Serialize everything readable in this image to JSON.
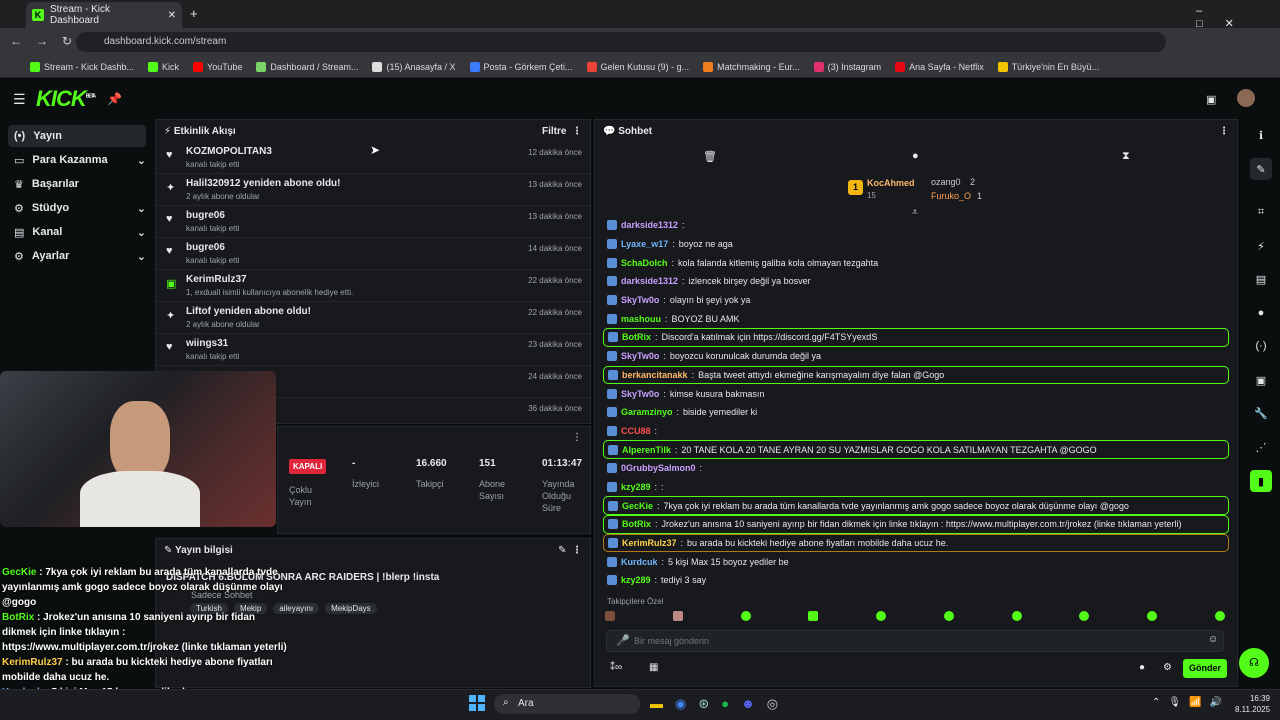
{
  "browser": {
    "tab_title": "Stream - Kick Dashboard",
    "url": "dashboard.kick.com/stream",
    "bookmarks": [
      "Stream - Kick Dashb...",
      "Kick",
      "YouTube",
      "Dashboard / Stream...",
      "(15) Anasayfa / X",
      "Posta - Görkem Çeti...",
      "Gelen Kutusu (9) - g...",
      "Matchmaking - Eur...",
      "(3) Instagram",
      "Ana Sayfa - Netflix",
      "Türkiye'nin En Büyü..."
    ]
  },
  "header": {
    "logo": "KICK",
    "beta": "BETA"
  },
  "nav": [
    {
      "label": "Yayın"
    },
    {
      "label": "Para Kazanma"
    },
    {
      "label": "Başarılar"
    },
    {
      "label": "Stüdyo"
    },
    {
      "label": "Kanal"
    },
    {
      "label": "Ayarlar"
    }
  ],
  "activity": {
    "title": "Etkinlik Akışı",
    "filter": "Filtre",
    "events": [
      {
        "name": "KOZMOPOLITAN3",
        "sub": "kanalı takip etti",
        "time": "12 dakika önce",
        "icon": "heart"
      },
      {
        "name": "Halil320912 yeniden abone oldu!",
        "sub": "2 aylık abone oldular",
        "time": "13 dakika önce",
        "icon": "star"
      },
      {
        "name": "bugre06",
        "sub": "kanalı takip etti",
        "time": "13 dakika önce",
        "icon": "heart"
      },
      {
        "name": "bugre06",
        "sub": "kanalı takip etti",
        "time": "14 dakika önce",
        "icon": "heart"
      },
      {
        "name": "KerimRulz37",
        "sub": "1, exduall isimli kullanıcıya abonelik hediye etti.",
        "time": "22 dakika önce",
        "icon": "gift"
      },
      {
        "name": "Liftof yeniden abone oldu!",
        "sub": "2 aylık abone oldular",
        "time": "22 dakika önce",
        "icon": "star"
      },
      {
        "name": "wiings31",
        "sub": "kanalı takip etti",
        "time": "23 dakika önce",
        "icon": "heart"
      },
      {
        "name": "",
        "sub": "",
        "time": "24 dakika önce",
        "icon": ""
      },
      {
        "name": "",
        "sub": "",
        "time": "36 dakika önce",
        "icon": ""
      }
    ]
  },
  "stats": {
    "status": "KAPALI",
    "items": [
      {
        "value": "-",
        "label": "İzleyici"
      },
      {
        "value": "16.660",
        "label": "Takipçi"
      },
      {
        "value": "151",
        "label": "Abone Sayısı"
      },
      {
        "value": "01:13:47",
        "label": "Yayında Olduğu Süre"
      }
    ],
    "multi": "Çoklu Yayın"
  },
  "streaminfo": {
    "title": "Yayın bilgisi",
    "stream_title": "DISPATCH 6.BÖLÜM SONRA ARC RAIDERS | !blerp !insta",
    "mode": "Sadece Sohbet",
    "tags": [
      "Turkish",
      "Mekip",
      "aileyayını",
      "MekipDays"
    ]
  },
  "chat": {
    "title": "Sohbet",
    "leader_1": "KocAhmed",
    "leader_1_count": "15",
    "leader_2": "ozang0",
    "leader_2_count": "2",
    "leader_3": "Furuko_O",
    "leader_3_count": "1",
    "messages": [
      {
        "user": "darkside1312",
        "text": "",
        "color": "#c9a0ff",
        "hl": ""
      },
      {
        "user": "Lyaxe_w17",
        "text": "boyoz ne aga",
        "color": "#70b7ff",
        "hl": ""
      },
      {
        "user": "SchaDolch",
        "text": "kola falanda kitlemiş galiba kola olmayan tezgahta",
        "color": "#53fc18",
        "hl": ""
      },
      {
        "user": "darkside1312",
        "text": "izlencek birşey değil ya bosver",
        "color": "#c9a0ff",
        "hl": ""
      },
      {
        "user": "SkyTw0o",
        "text": "olayın bi şeyi yok ya",
        "color": "#c9a0ff",
        "hl": ""
      },
      {
        "user": "mashouu",
        "text": "BOYOZ BU AMK",
        "color": "#53fc18",
        "hl": ""
      },
      {
        "user": "BotRix",
        "text": "Discord'a katılmak için https://discord.gg/F4TSYyexdS",
        "color": "#53fc18",
        "hl": "g"
      },
      {
        "user": "SkyTw0o",
        "text": "boyozcu korunulcak durumda değil ya",
        "color": "#c9a0ff",
        "hl": ""
      },
      {
        "user": "berkancitanakk",
        "text": "Başta tweet attıydı ekmeğine karışmayalım diye falan @Gogo",
        "color": "#ffb86b",
        "hl": "g"
      },
      {
        "user": "SkyTw0o",
        "text": "kimse kusura bakmasın",
        "color": "#c9a0ff",
        "hl": ""
      },
      {
        "user": "Garamzinyo",
        "text": "biside yemediler ki",
        "color": "#53fc18",
        "hl": ""
      },
      {
        "user": "CCU88",
        "text": "",
        "color": "#ff4d4d",
        "hl": ""
      },
      {
        "user": "AlperenTilk",
        "text": "20 TANE KOLA 20 TANE AYRAN 20 SU YAZMISLAR GOGO KOLA SATILMAYAN TEZGAHTA @GOGO",
        "color": "#53fc18",
        "hl": "g"
      },
      {
        "user": "0GrubbySalmon0",
        "text": "",
        "color": "#c9a0ff",
        "hl": ""
      },
      {
        "user": "kzy289",
        "text": ":",
        "color": "#53fc18",
        "hl": ""
      },
      {
        "user": "GecKie",
        "text": "7kya çok iyi reklam bu arada tüm kanallarda tvde yayınlanmış amk gogo sadece boyoz olarak düşünme olayı @gogo",
        "color": "#53fc18",
        "hl": "g"
      },
      {
        "user": "BotRix",
        "text": "Jrokez'un anısına 10 saniyeni ayırıp bir fidan dikmek için linke tıklayın : https://www.multiplayer.com.tr/jrokez (linke tıklaman yeterli)",
        "color": "#53fc18",
        "hl": "g"
      },
      {
        "user": "KerimRulz37",
        "text": "bu arada bu kickteki hediye abone fiyatları mobilde daha ucuz he.",
        "color": "#ffd24d",
        "hl": "o"
      },
      {
        "user": "Kurdcuk",
        "text": "5 kişi Max 15 boyoz yediler be",
        "color": "#70b7ff",
        "hl": ""
      },
      {
        "user": "kzy289",
        "text": "tediyi 3 say",
        "color": "#53fc18",
        "hl": ""
      }
    ],
    "followers_only": "Takipçilere Özel",
    "placeholder": "Bir mesaj gönderin",
    "send": "Gönder"
  },
  "overlay": [
    {
      "user": "GecKie",
      "text": " : 7kya çok iyi reklam bu arada tüm kanallarda tvde yayınlanmış amk gogo sadece boyoz olarak düşünme olayı @gogo"
    },
    {
      "user": "BotRix",
      "text": " : Jrokez'un anısına 10 saniyeni ayırıp bir fidan dikmek için linke tıklayın : https://www.multiplayer.com.tr/jrokez (linke tıklaman yeterli)"
    },
    {
      "user": "KerimRulz37",
      "text": " : bu arada bu kickteki hediye abone fiyatları mobilde daha ucuz he."
    },
    {
      "user": "Kurdcuk",
      "text": " : 5 kişi Max 15 boyoz yediler be"
    },
    {
      "user": "kzy289",
      "text": " : tediyi 3 say"
    }
  ],
  "taskbar": {
    "search": "Ara",
    "time": "16:39",
    "date": "8.11.2025"
  },
  "colors": {
    "accent": "#53fc18"
  }
}
